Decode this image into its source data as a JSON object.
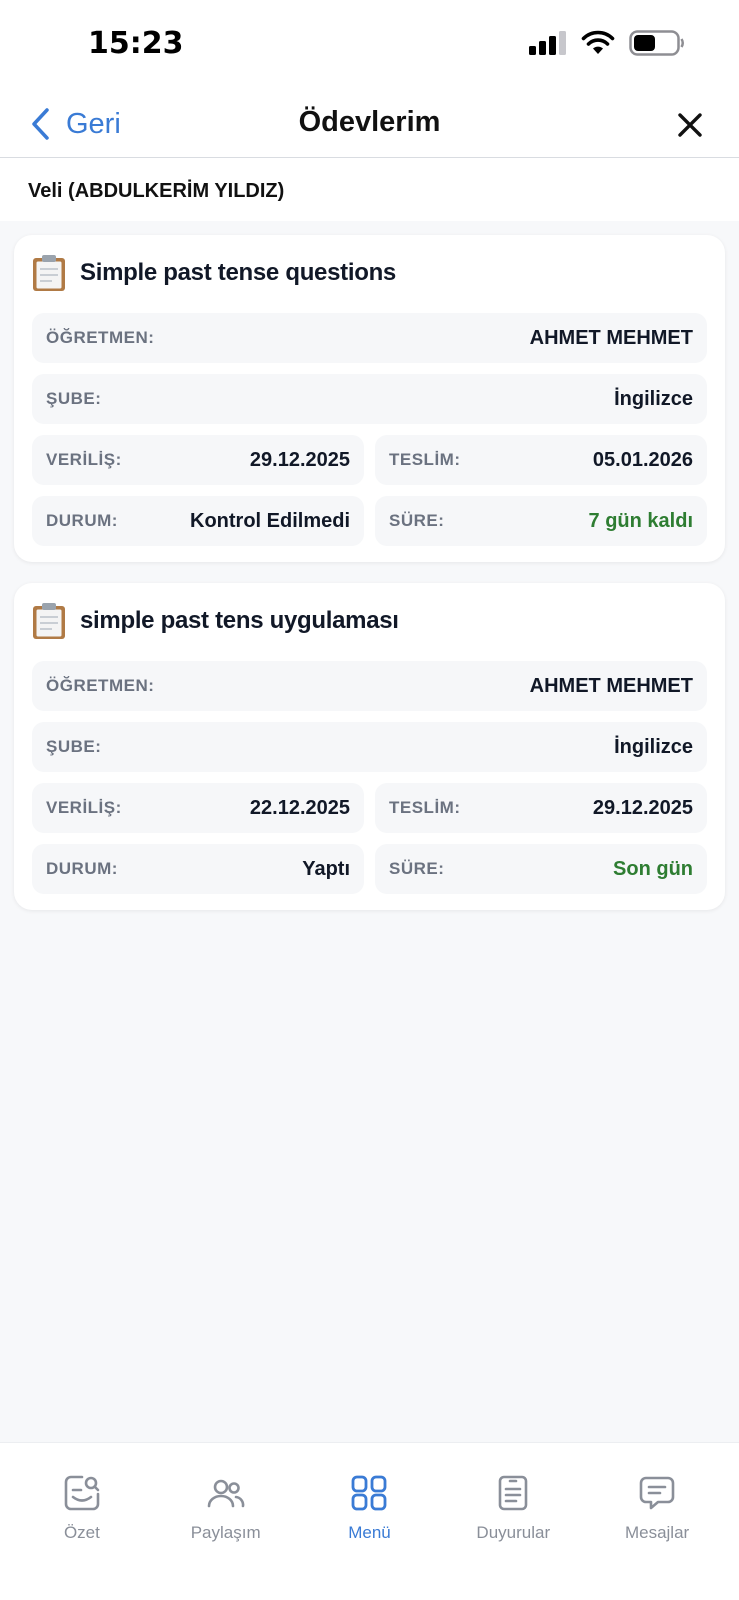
{
  "status_bar": {
    "time": "15:23"
  },
  "nav": {
    "back_label": "Geri",
    "title": "Ödevlerim"
  },
  "user_line": "Veli (ABDULKERİM YILDIZ)",
  "labels": {
    "teacher": "ÖĞRETMEN:",
    "branch": "ŞUBE:",
    "given": "VERİLİŞ:",
    "due": "TESLİM:",
    "status": "DURUM:",
    "remaining": "SÜRE:"
  },
  "assignments": [
    {
      "title": "Simple past tense questions",
      "teacher": "AHMET MEHMET",
      "branch": "İngilizce",
      "given": "29.12.2025",
      "due": "05.01.2026",
      "status": "Kontrol Edilmedi",
      "remaining": "7 gün kaldı"
    },
    {
      "title": "simple past tens uygulaması",
      "teacher": "AHMET MEHMET",
      "branch": "İngilizce",
      "given": "22.12.2025",
      "due": "29.12.2025",
      "status": "Yaptı",
      "remaining": "Son gün"
    }
  ],
  "tabs": [
    {
      "label": "Özet",
      "icon": "summary-icon"
    },
    {
      "label": "Paylaşım",
      "icon": "users-icon"
    },
    {
      "label": "Menü",
      "icon": "grid-icon",
      "active": true
    },
    {
      "label": "Duyurular",
      "icon": "document-icon"
    },
    {
      "label": "Mesajlar",
      "icon": "message-icon"
    }
  ],
  "colors": {
    "accent": "#3a7bd5",
    "success": "#2e7d32",
    "background": "#f7f8fa"
  }
}
